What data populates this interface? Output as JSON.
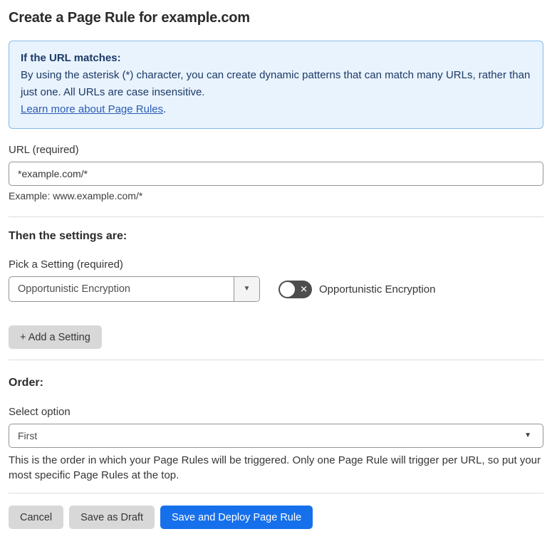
{
  "page_title": "Create a Page Rule for example.com",
  "info_box": {
    "heading": "If the URL matches:",
    "body": "By using the asterisk (*) character, you can create dynamic patterns that can match many URLs, rather than just one. All URLs are case insensitive.",
    "link_text": "Learn more about Page Rules",
    "link_suffix": "."
  },
  "url_field": {
    "label": "URL (required)",
    "value": "*example.com/*",
    "helper": "Example: www.example.com/*"
  },
  "settings_section": {
    "heading": "Then the settings are:",
    "picker_label": "Pick a Setting (required)",
    "picker_value": "Opportunistic Encryption",
    "dropdown_arrow": "▼",
    "toggle_state": "off",
    "toggle_x": "✕",
    "toggle_label": "Opportunistic Encryption",
    "add_setting_label": "+ Add a Setting"
  },
  "order_section": {
    "heading": "Order:",
    "select_label": "Select option",
    "select_value": "First",
    "select_arrow": "▼",
    "helper": "This is the order in which your Page Rules will be triggered. Only one Page Rule will trigger per URL, so put your most specific Page Rules at the top."
  },
  "footer": {
    "cancel_label": "Cancel",
    "save_draft_label": "Save as Draft",
    "save_deploy_label": "Save and Deploy Page Rule"
  },
  "colors": {
    "info_background": "#e9f3fd",
    "info_border": "#84bae9",
    "info_text": "#1c3a66",
    "link_blue": "#2b5cb7",
    "primary_button_blue": "#1670ec",
    "secondary_button_gray": "#d8d8d8",
    "toggle_off_gray": "#4d4d4d",
    "input_border_gray": "#949494"
  }
}
